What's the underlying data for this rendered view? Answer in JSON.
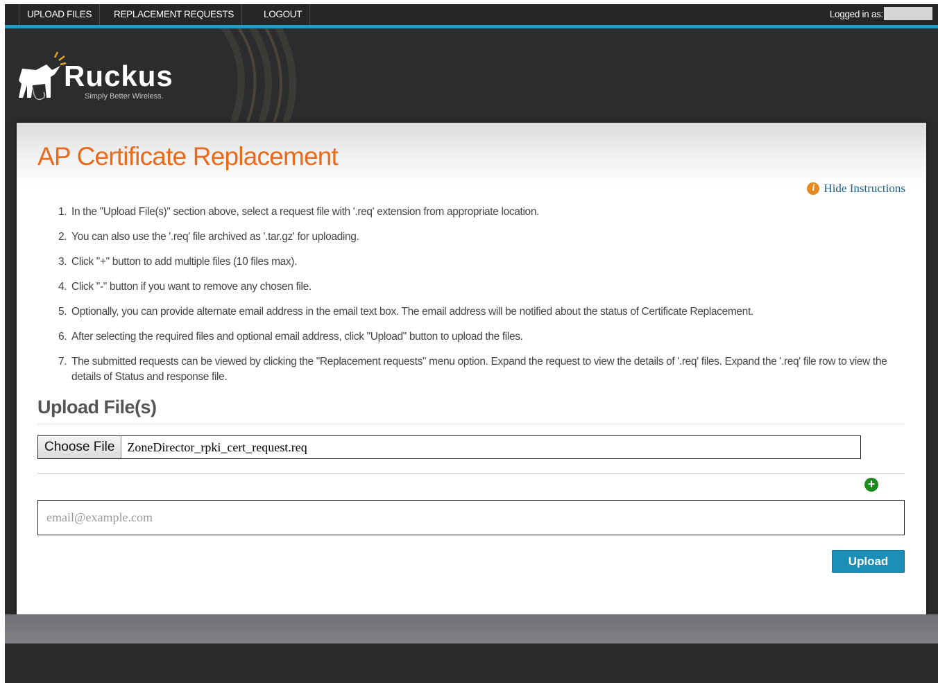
{
  "nav": {
    "items": [
      {
        "label": "UPLOAD FILES"
      },
      {
        "label": "REPLACEMENT REQUESTS"
      },
      {
        "label": "LOGOUT"
      }
    ],
    "logged_in_label": "Logged in as:"
  },
  "header": {
    "logo_text": "Ruckus",
    "tagline": "Simply Better Wireless."
  },
  "main": {
    "title": "AP Certificate Replacement",
    "hide_instructions_label": "Hide Instructions",
    "instructions": [
      {
        "num": "1.",
        "text": "In the \"Upload File(s)\" section above, select a request file with '.req' extension from appropriate location."
      },
      {
        "num": "2.",
        "text": "You can also use the '.req' file archived as '.tar.gz' for uploading."
      },
      {
        "num": "3.",
        "text": "Click \"+\" button to add multiple files (10 files max)."
      },
      {
        "num": "4.",
        "text": "Click \"-\" button if you want to remove any chosen file."
      },
      {
        "num": "5.",
        "text": "Optionally, you can provide alternate email address in the email text box. The email address will be notified about the status of Certificate Replacement."
      },
      {
        "num": "6.",
        "text": "After selecting the required files and optional email address, click \"Upload\" button to upload the files."
      },
      {
        "num": "7.",
        "text": "The submitted requests can be viewed by clicking the \"Replacement requests\" menu option. Expand the request to view the details of '.req' files. Expand the '.req' file row to view the details of Status and response file."
      }
    ],
    "upload_section_title": "Upload File(s)",
    "choose_file_label": "Choose File",
    "file_name": "ZoneDirector_rpki_cert_request.req",
    "email_placeholder": "email@example.com",
    "upload_button_label": "Upload"
  },
  "colors": {
    "accent_bar": "#1f9cc4",
    "title_orange": "#e96a1a",
    "upload_button": "#1b8fb8",
    "add_icon_green": "#1e8b1e",
    "info_icon_orange": "#e68a1f"
  },
  "icons": {
    "info": "info-icon",
    "add": "plus-circle-icon",
    "logo": "ruckus-dog-logo-icon"
  }
}
